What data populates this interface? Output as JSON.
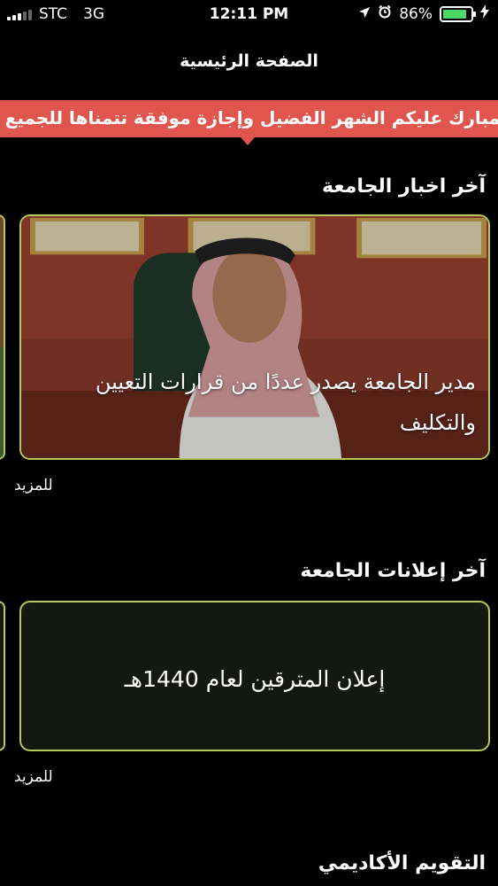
{
  "status_bar": {
    "carrier": "STC",
    "network": "3G",
    "time": "12:11 PM",
    "battery_percent": "86%",
    "battery_level": 0.86,
    "icons": [
      "location-arrow-icon",
      "alarm-clock-icon",
      "battery-icon",
      "charging-bolt-icon"
    ]
  },
  "header": {
    "title": "الصفحة الرئيسية"
  },
  "banner": {
    "text": "مبارك عليكم الشهر الفضيل وإجازة موفقة تتمناها للجميع"
  },
  "news": {
    "section_title": "آخر اخبار الجامعة",
    "card": {
      "caption": "مدير الجامعة يصدر عددًا من قرارات التعيين والتكليف"
    },
    "more_label": "للمزيد"
  },
  "announcements": {
    "section_title": "آخر إعلانات الجامعة",
    "card": {
      "text": "إعلان المترقين لعام 1440هـ"
    },
    "more_label": "للمزيد"
  },
  "calendar": {
    "section_title": "التقويم الأكاديمي"
  },
  "colors": {
    "banner": "#e0554d",
    "card_border": "#b6c95e",
    "battery_fill": "#4cd964",
    "background": "#000000"
  }
}
